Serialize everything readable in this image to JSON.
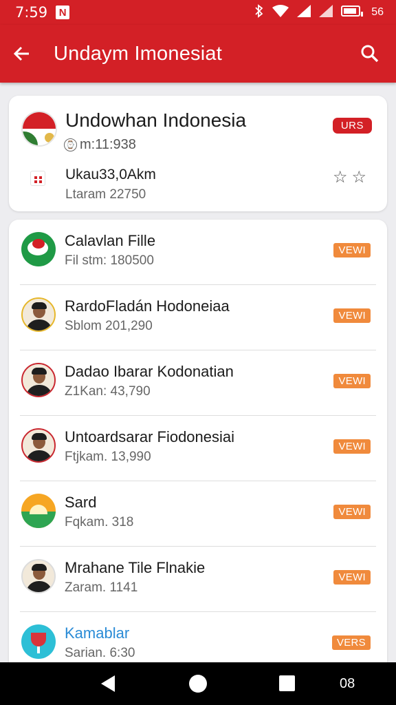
{
  "status_bar": {
    "time": "7:59",
    "notification": "N",
    "battery": "56"
  },
  "app_bar": {
    "title": "Undaym Imonesiat",
    "back_icon": "back-arrow-icon",
    "search_icon": "search-icon"
  },
  "top_card": {
    "title": "Undowhan Indonesia",
    "subtitle": "m:11:938",
    "badge": "URS",
    "line2": "Ukau33,0Akm",
    "line3": "Ltaram 22750"
  },
  "list": [
    {
      "title": "Calavlan Fille",
      "subtitle": "Fil stm: 180500",
      "badge": "VEWI",
      "avatar": "green-logo"
    },
    {
      "title": "RardoFladán Hodoneiaa",
      "subtitle": "Sblom 201,290",
      "badge": "VEWI",
      "avatar": "person-yellow"
    },
    {
      "title": "Dadao Ibarar Kodonatian",
      "subtitle": "Z1Kan: 43,790",
      "badge": "VEWI",
      "avatar": "person-red"
    },
    {
      "title": "Untoardsarar Fiodonesiai",
      "subtitle": "Ftjkam. 13,990",
      "badge": "VEWI",
      "avatar": "person-red"
    },
    {
      "title": "Sard",
      "subtitle": "Fqkam. 318",
      "badge": "VEWI",
      "avatar": "sun-logo"
    },
    {
      "title": "Mrahane Tile Flnakie",
      "subtitle": "Zaram. 1141",
      "badge": "VEWI",
      "avatar": "person-plain"
    },
    {
      "title": "Kamablar",
      "subtitle": "Sarian. 6:30",
      "badge": "VERS",
      "avatar": "cup-logo"
    }
  ],
  "nav_bar": {
    "extra": "08"
  }
}
